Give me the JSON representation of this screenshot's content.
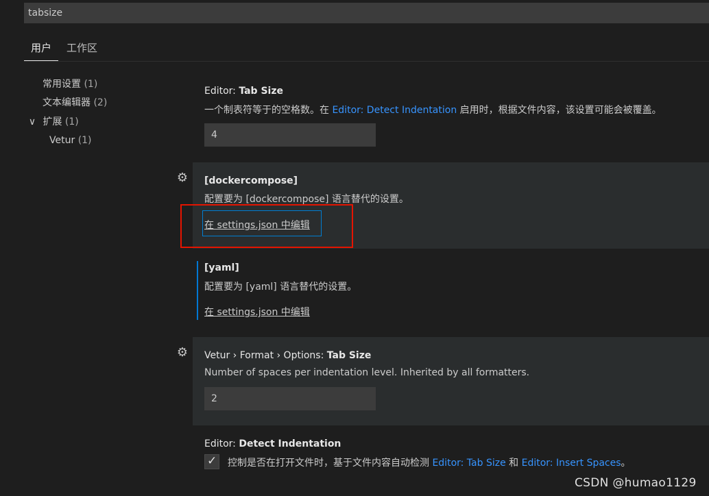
{
  "search": {
    "value": "tabsize"
  },
  "tabs": [
    {
      "label": "用户"
    },
    {
      "label": "工作区"
    }
  ],
  "toc": [
    {
      "label": "常用设置",
      "count": "(1)"
    },
    {
      "label": "文本编辑器",
      "count": "(2)"
    },
    {
      "label": "扩展",
      "count": "(1)",
      "chevron": "∨"
    },
    {
      "label": "Vetur",
      "count": "(1)"
    }
  ],
  "settings": {
    "tab_size": {
      "category": "Editor: ",
      "name": "Tab Size",
      "desc_before": "一个制表符等于的空格数。在 ",
      "desc_link": "Editor: Detect Indentation",
      "desc_after": " 启用时，根据文件内容，该设置可能会被覆盖。",
      "value": "4"
    },
    "dockercompose": {
      "name": "[dockercompose]",
      "desc": "配置要为 [dockercompose] 语言替代的设置。",
      "edit_link": "在 settings.json 中编辑"
    },
    "yaml": {
      "name": "[yaml]",
      "desc": "配置要为 [yaml] 语言替代的设置。",
      "edit_link": "在 settings.json 中编辑"
    },
    "vetur_tab_size": {
      "category": "Vetur › Format › Options: ",
      "name": "Tab Size",
      "desc": "Number of spaces per indentation level. Inherited by all formatters.",
      "value": "2"
    },
    "detect_indentation": {
      "category": "Editor: ",
      "name": "Detect Indentation",
      "desc_before": "控制是否在打开文件时，基于文件内容自动检测 ",
      "link1": "Editor: Tab Size",
      "desc_mid": " 和 ",
      "link2": "Editor: Insert Spaces",
      "desc_after": "。",
      "checked": true,
      "check_glyph": "✓"
    }
  },
  "icons": {
    "gear": "⚙"
  },
  "watermark": "CSDN @humao1129",
  "colors": {
    "accent": "#3794ff",
    "focus": "#007fd4",
    "annotation": "#e51400"
  }
}
